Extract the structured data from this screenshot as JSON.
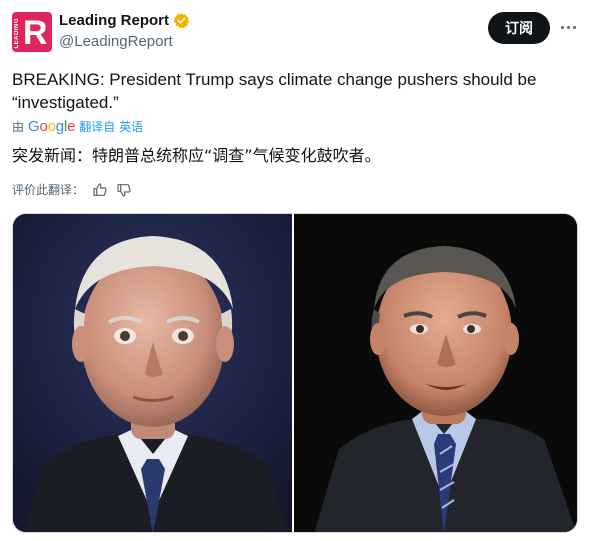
{
  "account": {
    "display_name": "Leading Report",
    "handle": "@LeadingReport",
    "avatar_letter": "R",
    "avatar_vertical_text": "LEADING"
  },
  "actions": {
    "subscribe_label": "订阅"
  },
  "tweet": {
    "text_line1": "BREAKING: President Trump says climate change pushers should be",
    "text_line2": "“investigated.”"
  },
  "translation": {
    "by_label": "由",
    "google_letters": [
      "G",
      "o",
      "o",
      "g",
      "l",
      "e"
    ],
    "link_label": "翻译自 英语",
    "translated_text": "突发新闻：特朗普总统称应“调查”气候变化鼓吹者。"
  },
  "rating": {
    "label": "评价此翻译："
  },
  "colors": {
    "accent_blue": "#1d9bf0",
    "brand_red": "#e0245e",
    "verified_gold": "#f4b400",
    "text_primary": "#0f1419",
    "text_secondary": "#536471"
  }
}
